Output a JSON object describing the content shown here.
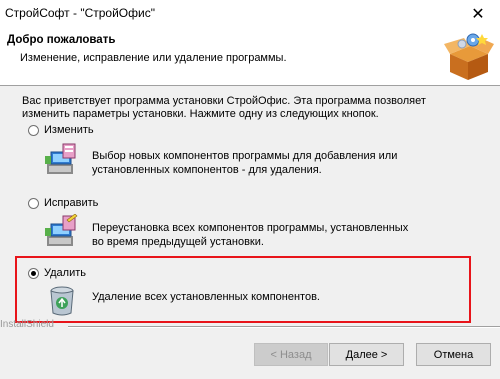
{
  "window": {
    "title": "СтройСофт - \"СтройОфис\"",
    "close_glyph": "✕"
  },
  "header": {
    "title": "Добро пожаловать",
    "subtitle": "Изменение, исправление или удаление программы."
  },
  "intro": "Вас приветствует программа установки СтройОфис. Эта программа позволяет изменить параметры установки. Нажмите одну из следующих кнопок.",
  "options": [
    {
      "label": "Изменить",
      "description": "Выбор новых компонентов программы для добавления или установленных компонентов - для удаления.",
      "selected": false,
      "icon": "modify-setup-icon"
    },
    {
      "label": "Исправить",
      "description": "Переустановка всех компонентов программы, установленных во время предыдущей установки.",
      "selected": false,
      "icon": "repair-setup-icon"
    },
    {
      "label": "Удалить",
      "description": "Удаление всех установленных компонентов.",
      "selected": true,
      "icon": "recycle-bin-icon"
    }
  ],
  "footer": {
    "brand": "InstallShield",
    "back_label": "< Назад",
    "next_label": "Далее >",
    "cancel_label": "Отмена"
  },
  "colors": {
    "highlight": "#e8141a",
    "header_bg": "#ffffff",
    "dialog_bg": "#f0f0f0"
  }
}
